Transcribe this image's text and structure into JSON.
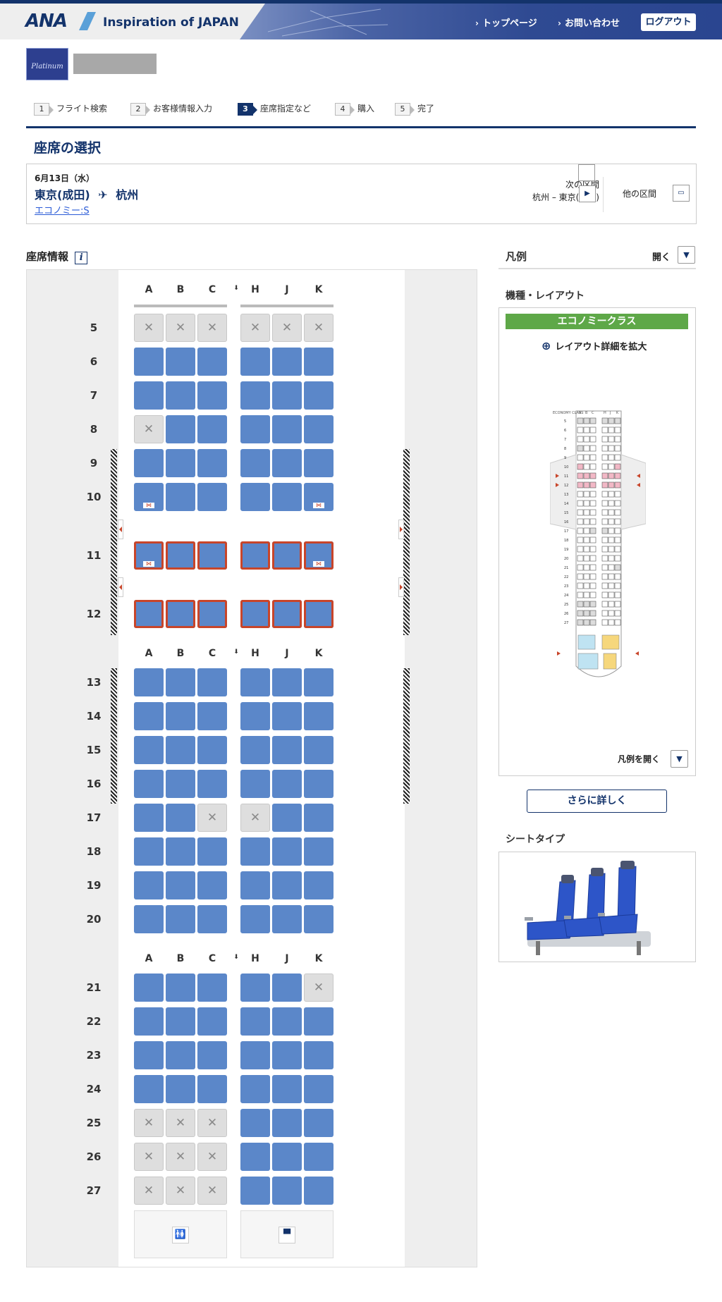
{
  "header": {
    "brand": "ANA",
    "tagline": "Inspiration of JAPAN",
    "nav": [
      "トップページ",
      "お問い合わせ"
    ],
    "logout": "ログアウト"
  },
  "member": {
    "badge": "Platinum"
  },
  "steps": [
    {
      "num": "1",
      "label": "フライト検索"
    },
    {
      "num": "2",
      "label": "お客様情報入力"
    },
    {
      "num": "3",
      "label": "座席指定など",
      "current": true
    },
    {
      "num": "4",
      "label": "購入"
    },
    {
      "num": "5",
      "label": "完了"
    }
  ],
  "page_title": "座席の選択",
  "flight": {
    "date": "6月13日（水）",
    "origin": "東京(成田)",
    "destination": "杭州",
    "fare_class": "エコノミー:S",
    "next_label": "次の区間",
    "next_route": "杭州 –  東京(成田)",
    "other_label": "他の区間"
  },
  "seat_info_label": "座席情報",
  "columns_left": [
    "A",
    "B",
    "C"
  ],
  "columns_right": [
    "H",
    "J",
    "K"
  ],
  "rows": [
    {
      "num": "5",
      "seats": [
        "x",
        "x",
        "x",
        "x",
        "x",
        "x"
      ]
    },
    {
      "num": "6",
      "seats": [
        "o",
        "o",
        "o",
        "o",
        "o",
        "o"
      ]
    },
    {
      "num": "7",
      "seats": [
        "o",
        "o",
        "o",
        "o",
        "o",
        "o"
      ]
    },
    {
      "num": "8",
      "seats": [
        "x",
        "o",
        "o",
        "o",
        "o",
        "o"
      ]
    },
    {
      "num": "9",
      "seats": [
        "o",
        "o",
        "o",
        "o",
        "o",
        "o"
      ]
    },
    {
      "num": "10",
      "seats": [
        "o",
        "o",
        "o",
        "o",
        "o",
        "o"
      ],
      "bassinet": [
        0,
        5
      ]
    },
    {
      "num": "11",
      "seats": [
        "o",
        "o",
        "o",
        "o",
        "o",
        "o"
      ],
      "exit": true,
      "bassinet": [
        0,
        5
      ]
    },
    {
      "num": "12",
      "seats": [
        "o",
        "o",
        "o",
        "o",
        "o",
        "o"
      ],
      "exit": true
    },
    {
      "num": "13",
      "seats": [
        "o",
        "o",
        "o",
        "o",
        "o",
        "o"
      ]
    },
    {
      "num": "14",
      "seats": [
        "o",
        "o",
        "o",
        "o",
        "o",
        "o"
      ]
    },
    {
      "num": "15",
      "seats": [
        "o",
        "o",
        "o",
        "o",
        "o",
        "o"
      ]
    },
    {
      "num": "16",
      "seats": [
        "o",
        "o",
        "o",
        "o",
        "o",
        "o"
      ]
    },
    {
      "num": "17",
      "seats": [
        "o",
        "o",
        "x",
        "x",
        "o",
        "o"
      ]
    },
    {
      "num": "18",
      "seats": [
        "o",
        "o",
        "o",
        "o",
        "o",
        "o"
      ]
    },
    {
      "num": "19",
      "seats": [
        "o",
        "o",
        "o",
        "o",
        "o",
        "o"
      ]
    },
    {
      "num": "20",
      "seats": [
        "o",
        "o",
        "o",
        "o",
        "o",
        "o"
      ]
    },
    {
      "num": "21",
      "seats": [
        "o",
        "o",
        "o",
        "o",
        "o",
        "x"
      ]
    },
    {
      "num": "22",
      "seats": [
        "o",
        "o",
        "o",
        "o",
        "o",
        "o"
      ]
    },
    {
      "num": "23",
      "seats": [
        "o",
        "o",
        "o",
        "o",
        "o",
        "o"
      ]
    },
    {
      "num": "24",
      "seats": [
        "o",
        "o",
        "o",
        "o",
        "o",
        "o"
      ]
    },
    {
      "num": "25",
      "seats": [
        "x",
        "x",
        "x",
        "o",
        "o",
        "o"
      ]
    },
    {
      "num": "26",
      "seats": [
        "x",
        "x",
        "x",
        "o",
        "o",
        "o"
      ]
    },
    {
      "num": "27",
      "seats": [
        "x",
        "x",
        "x",
        "o",
        "o",
        "o"
      ]
    }
  ],
  "facilities": [
    {
      "icon": "lavatory-icon"
    },
    {
      "icon": "galley-icon"
    }
  ],
  "legend": {
    "title": "凡例",
    "open": "開く"
  },
  "layout": {
    "title": "機種・レイアウト",
    "class_label": "エコノミークラス",
    "zoom_label": "レイアウト詳細を拡大",
    "mini_class": "ECONOMY CLASS",
    "mini_cols": [
      "A",
      "B",
      "C",
      "H",
      "J",
      "K"
    ],
    "legend_open": "凡例を開く"
  },
  "more_button": "さらに詳しく",
  "seat_type": {
    "title": "シートタイプ"
  },
  "colors": {
    "available": "#5b87c9",
    "unavailable": "#dedede",
    "exit": "#c8452a",
    "navy": "#13336b",
    "economy": "#5ea848"
  }
}
